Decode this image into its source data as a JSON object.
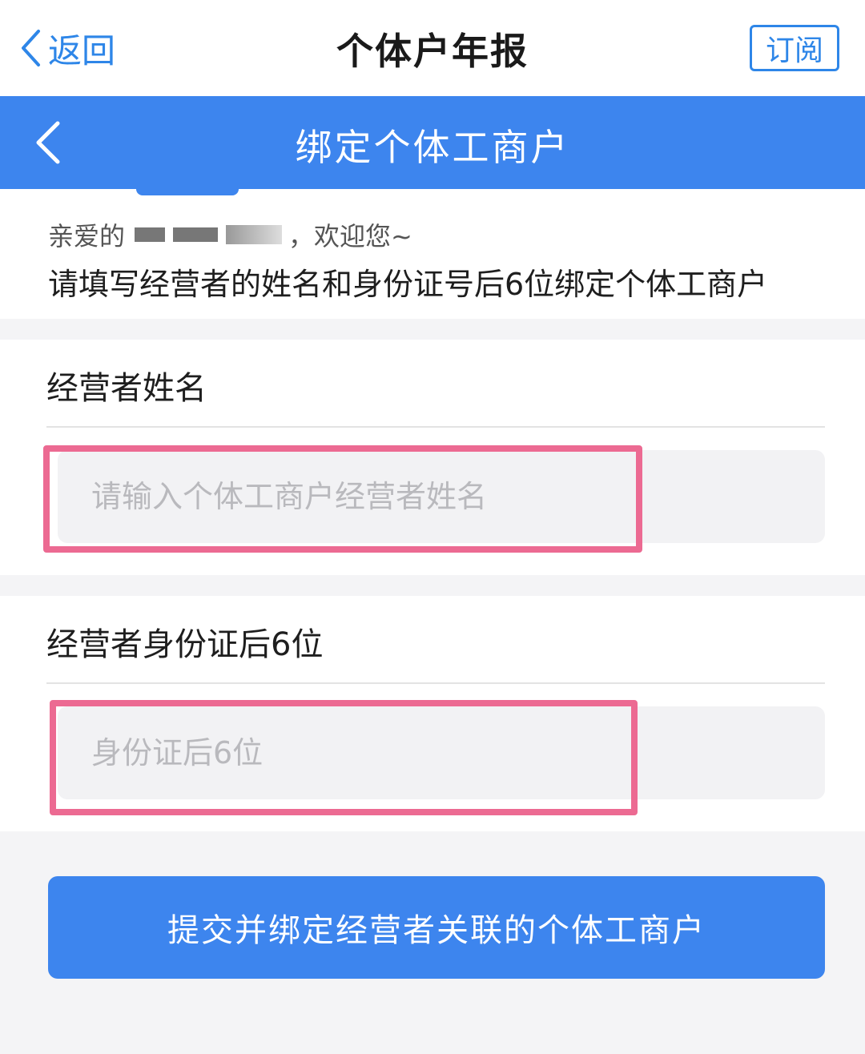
{
  "top_bar": {
    "back_label": "返回",
    "title": "个体户年报",
    "subscribe_label": "订阅"
  },
  "nav_bar": {
    "title": "绑定个体工商户"
  },
  "greeting": {
    "prefix": "亲爱的",
    "suffix": "，欢迎您~",
    "instruction": "请填写经营者的姓名和身份证号后6位绑定个体工商户"
  },
  "form": {
    "name_section": {
      "label": "经营者姓名",
      "placeholder": "请输入个体工商户经营者姓名",
      "value": ""
    },
    "id_section": {
      "label": "经营者身份证后6位",
      "placeholder": "身份证后6位",
      "value": ""
    }
  },
  "submit_label": "提交并绑定经营者关联的个体工商户",
  "colors": {
    "brand_blue": "#3d85ee",
    "link_blue": "#2e86e8",
    "highlight_pink": "#ec6a92",
    "page_bg": "#f4f4f6"
  }
}
